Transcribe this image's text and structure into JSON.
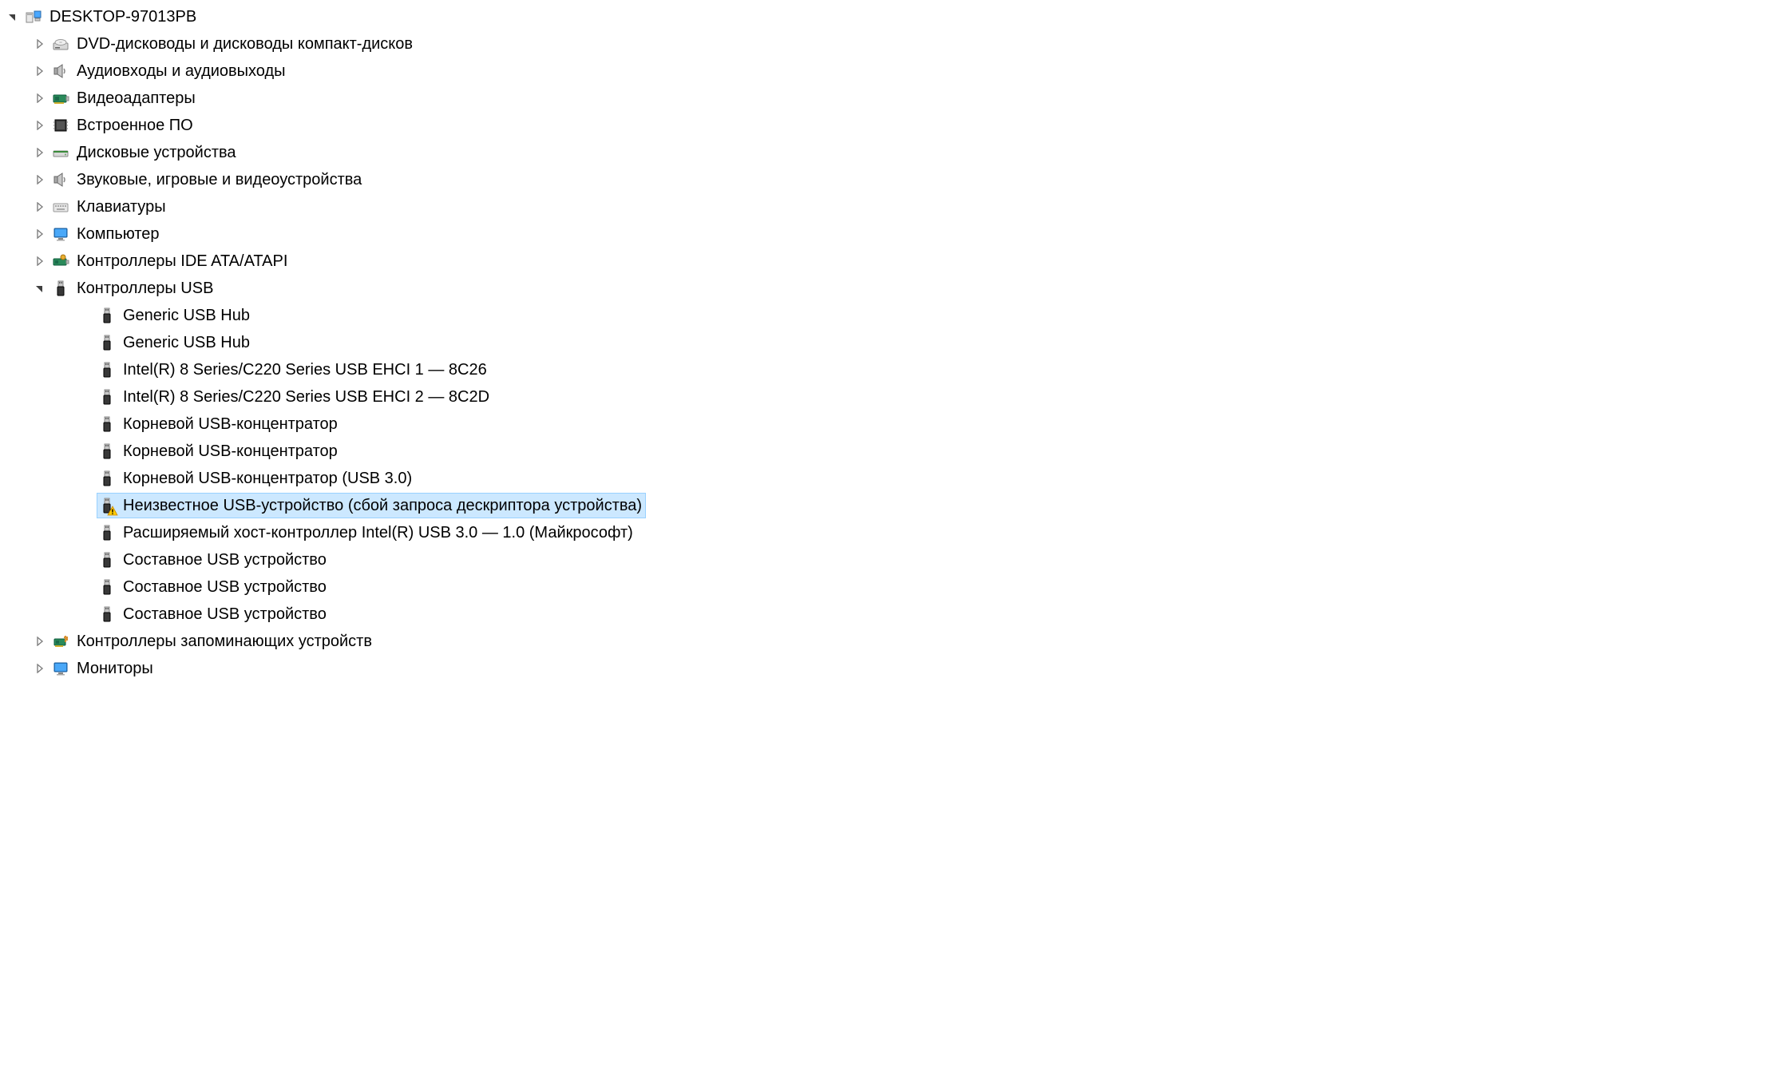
{
  "root": {
    "label": "DESKTOP-97013PB",
    "expanded": true
  },
  "categories": [
    {
      "label": "DVD-дисководы и дисководы компакт-дисков",
      "icon": "optical-drive",
      "expanded": false
    },
    {
      "label": "Аудиовходы и аудиовыходы",
      "icon": "speaker",
      "expanded": false
    },
    {
      "label": "Видеоадаптеры",
      "icon": "display-adapter",
      "expanded": false
    },
    {
      "label": "Встроенное ПО",
      "icon": "firmware",
      "expanded": false
    },
    {
      "label": "Дисковые устройства",
      "icon": "disk-drive",
      "expanded": false
    },
    {
      "label": "Звуковые, игровые и видеоустройства",
      "icon": "speaker",
      "expanded": false
    },
    {
      "label": "Клавиатуры",
      "icon": "keyboard",
      "expanded": false
    },
    {
      "label": "Компьютер",
      "icon": "monitor",
      "expanded": false
    },
    {
      "label": "Контроллеры IDE ATA/ATAPI",
      "icon": "ide-controller",
      "expanded": false
    },
    {
      "label": "Контроллеры USB",
      "icon": "usb",
      "expanded": true,
      "children": [
        {
          "label": "Generic USB Hub",
          "icon": "usb",
          "warning": false
        },
        {
          "label": "Generic USB Hub",
          "icon": "usb",
          "warning": false
        },
        {
          "label": "Intel(R) 8 Series/C220 Series USB EHCI 1 — 8C26",
          "icon": "usb",
          "warning": false
        },
        {
          "label": "Intel(R) 8 Series/C220 Series USB EHCI 2 — 8C2D",
          "icon": "usb",
          "warning": false
        },
        {
          "label": "Корневой USB-концентратор",
          "icon": "usb",
          "warning": false
        },
        {
          "label": "Корневой USB-концентратор",
          "icon": "usb",
          "warning": false
        },
        {
          "label": "Корневой USB-концентратор (USB 3.0)",
          "icon": "usb",
          "warning": false
        },
        {
          "label": "Неизвестное USB-устройство (сбой запроса дескриптора устройства)",
          "icon": "usb",
          "warning": true,
          "selected": true
        },
        {
          "label": "Расширяемый хост-контроллер Intel(R) USB 3.0 — 1.0 (Майкрософт)",
          "icon": "usb",
          "warning": false
        },
        {
          "label": "Составное USB устройство",
          "icon": "usb",
          "warning": false
        },
        {
          "label": "Составное USB устройство",
          "icon": "usb",
          "warning": false
        },
        {
          "label": "Составное USB устройство",
          "icon": "usb",
          "warning": false
        }
      ]
    },
    {
      "label": "Контроллеры запоминающих устройств",
      "icon": "storage-controller",
      "expanded": false
    },
    {
      "label": "Мониторы",
      "icon": "monitor",
      "expanded": false
    }
  ]
}
